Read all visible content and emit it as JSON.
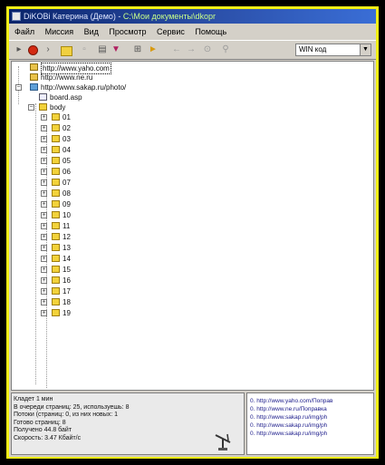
{
  "window": {
    "title": "DiKOBi Катерина (Демо)",
    "title_path": "C:\\Мои документы\\dkopr"
  },
  "menu": {
    "items": [
      "Файл",
      "Миссия",
      "Вид",
      "Просмотр",
      "Сервис",
      "Помощь"
    ]
  },
  "toolbar": {
    "combo_value": "WIN код"
  },
  "tree": {
    "roots": [
      {
        "label": "http://www.yaho.com",
        "icon": "page-icon",
        "selected": true
      },
      {
        "label": "http://www.ne.ru",
        "icon": "page-icon",
        "selected": false
      },
      {
        "label": "http://www.sakap.ru/photo/",
        "icon": "site-icon",
        "selected": false
      }
    ],
    "children": [
      {
        "label": "board.asp",
        "icon": "file-icon"
      },
      {
        "label": "body",
        "icon": "folder-icon"
      }
    ],
    "folders": [
      "01",
      "02",
      "03",
      "04",
      "05",
      "06",
      "07",
      "08",
      "09",
      "10",
      "11",
      "12",
      "13",
      "14",
      "15",
      "16",
      "17",
      "18",
      "19"
    ]
  },
  "status": {
    "lines": [
      "Кладет 1 мин",
      "В очереди страниц: 25, используешь: 8",
      "Потоки (страниц: 0, из них новых: 1",
      "Готово страниц: 8",
      "Получено 44.8 байт",
      "Скорость: 3.47 Кбайт/с"
    ]
  },
  "log": {
    "lines": [
      "0. http://www.yaho.com/Поправ",
      "0. http://www.ne.ru/Поправка",
      "0. http://www.sakap.ru/img/ph",
      "0. http://www.sakap.ru/img/ph",
      "0. http://www.sakap.ru/img/ph"
    ]
  }
}
